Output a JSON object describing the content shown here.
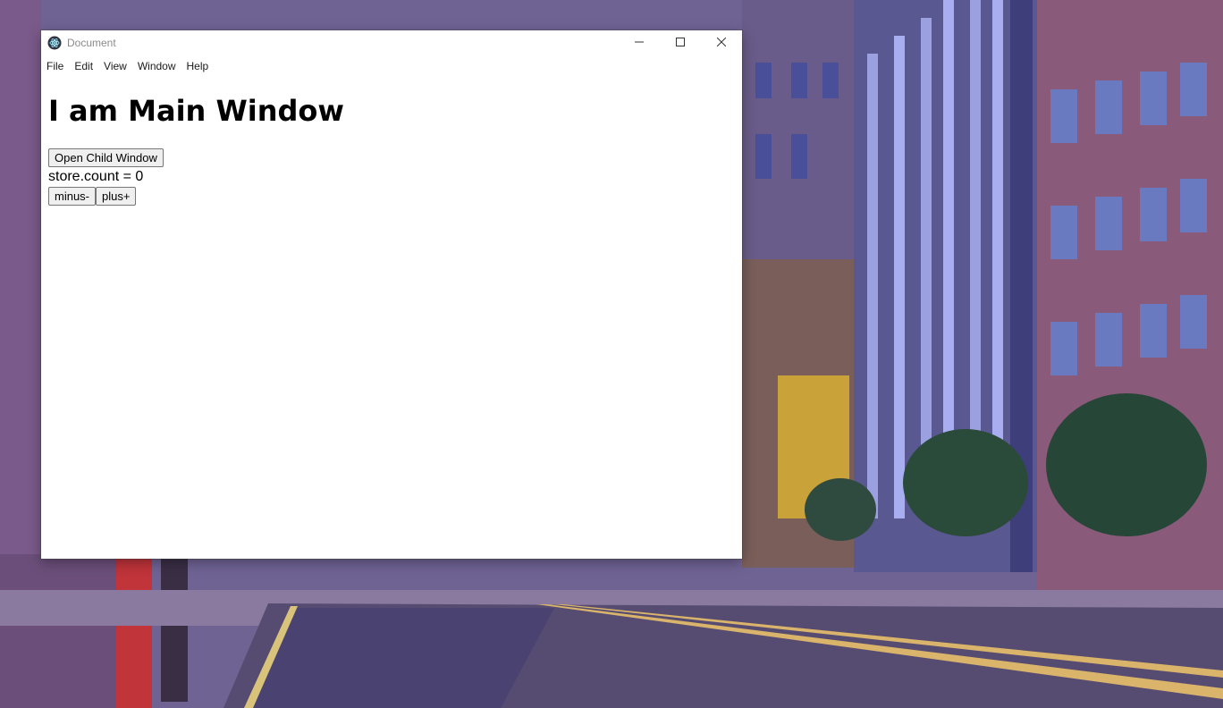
{
  "window": {
    "title": "Document"
  },
  "menu": {
    "items": [
      "File",
      "Edit",
      "View",
      "Window",
      "Help"
    ]
  },
  "main": {
    "heading": "I am Main Window",
    "open_child_label": "Open Child Window",
    "count_label": "store.count = 0",
    "minus_label": "minus-",
    "plus_label": "plus+"
  },
  "icons": {
    "app": "electron-logo-icon",
    "minimize": "minimize-icon",
    "maximize": "maximize-icon",
    "close": "close-icon"
  },
  "colors": {
    "window_bg": "#ffffff",
    "title_text": "#8a8a8a",
    "wallpaper_sky": "#7d6f9c",
    "wallpaper_street": "#4a4460"
  }
}
